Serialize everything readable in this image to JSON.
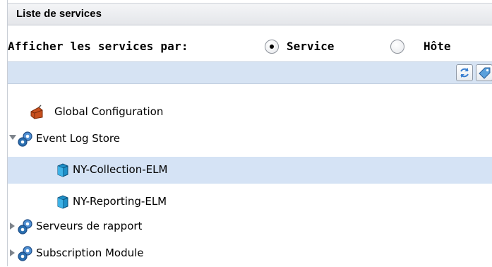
{
  "panel": {
    "title": "Liste de services"
  },
  "filter": {
    "label": "Afficher les services par:",
    "options": [
      {
        "label": "Service",
        "selected": true
      },
      {
        "label": "Hôte",
        "selected": false
      }
    ]
  },
  "toolbar": {
    "buttons": [
      {
        "icon": "refresh-icon"
      },
      {
        "icon": "tag-icon"
      }
    ]
  },
  "tree": {
    "items": [
      {
        "label": "Global Configuration",
        "icon": "configuration-icon",
        "expander": "none",
        "selected": false
      },
      {
        "label": "Event Log Store",
        "icon": "service-group-icon",
        "expander": "expanded",
        "selected": false
      },
      {
        "label": "NY-Collection-ELM",
        "icon": "host-icon",
        "expander": "none",
        "selected": true
      },
      {
        "label": "NY-Reporting-ELM",
        "icon": "host-icon",
        "expander": "none",
        "selected": false
      },
      {
        "label": "Serveurs de rapport",
        "icon": "service-group-icon",
        "expander": "collapsed",
        "selected": false
      },
      {
        "label": "Subscription Module",
        "icon": "service-group-icon",
        "expander": "collapsed",
        "selected": false
      }
    ]
  },
  "colors": {
    "selection": "#d5e3f5",
    "toolbar": "#d6e3f3",
    "host_icon": "#1e90c8",
    "group_icon": "#2a6fb0",
    "config_icon": "#c8501e"
  }
}
